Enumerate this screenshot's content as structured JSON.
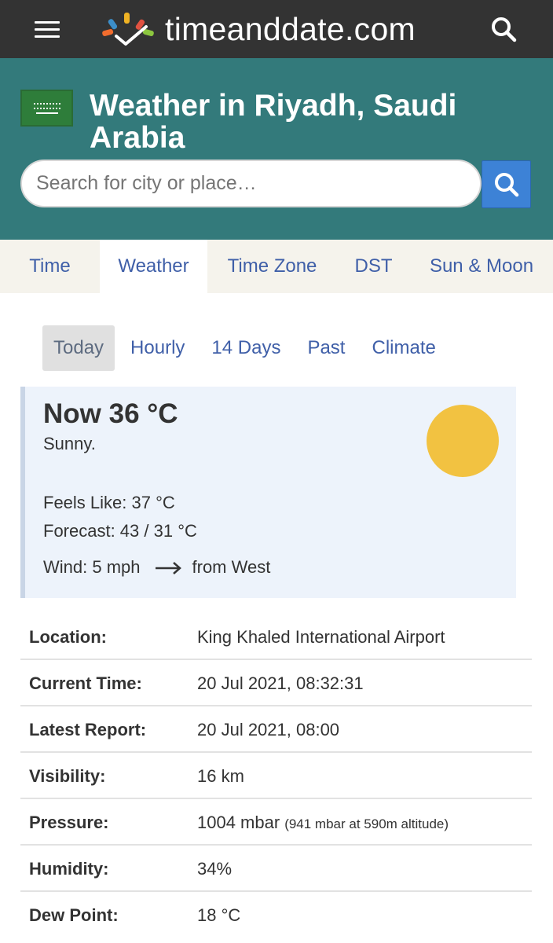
{
  "header": {
    "logo_text": "timeanddate.com",
    "menu_icon": "hamburger-menu-icon",
    "search_icon": "search-icon",
    "logo_colors": [
      "#f0b324",
      "#e15241",
      "#3c8ec8",
      "#8cc63f",
      "#f26d2e"
    ]
  },
  "hero": {
    "title": "Weather in Riyadh, Saudi Arabia",
    "flag_icon": "saudi-arabia-flag-icon",
    "background": "#337a7b",
    "search": {
      "placeholder": "Search for city or place…",
      "button_icon": "search-icon",
      "button_color": "#3d82d6"
    }
  },
  "nav": {
    "tabs": [
      {
        "label": "Time",
        "active": false
      },
      {
        "label": "Weather",
        "active": true
      },
      {
        "label": "Time Zone",
        "active": false
      },
      {
        "label": "DST",
        "active": false
      },
      {
        "label": "Sun & Moon",
        "active": false
      }
    ]
  },
  "subnav": {
    "tabs": [
      {
        "label": "Today",
        "active": true
      },
      {
        "label": "Hourly",
        "active": false
      },
      {
        "label": "14 Days",
        "active": false
      },
      {
        "label": "Past",
        "active": false
      },
      {
        "label": "Climate",
        "active": false
      }
    ]
  },
  "now": {
    "temp": "Now 36 °C",
    "description": "Sunny.",
    "weather_icon": "sun-icon",
    "sun_color": "#f2c241",
    "feels_like": "Feels Like: 37 °C",
    "forecast": "Forecast: 43 / 31 °C",
    "wind_speed": "Wind: 5 mph",
    "wind_arrow": "arrow-right-icon",
    "wind_direction": "from West"
  },
  "details": [
    {
      "label": "Location:",
      "value": "King Khaled International Airport",
      "note": ""
    },
    {
      "label": "Current Time:",
      "value": "20 Jul 2021, 08:32:31",
      "note": ""
    },
    {
      "label": "Latest Report:",
      "value": "20 Jul 2021, 08:00",
      "note": ""
    },
    {
      "label": "Visibility:",
      "value": "16 km",
      "note": ""
    },
    {
      "label": "Pressure:",
      "value": "1004 mbar",
      "note": "(941 mbar at 590m altitude)"
    },
    {
      "label": "Humidity:",
      "value": "34%",
      "note": ""
    },
    {
      "label": "Dew Point:",
      "value": "18 °C",
      "note": ""
    }
  ]
}
